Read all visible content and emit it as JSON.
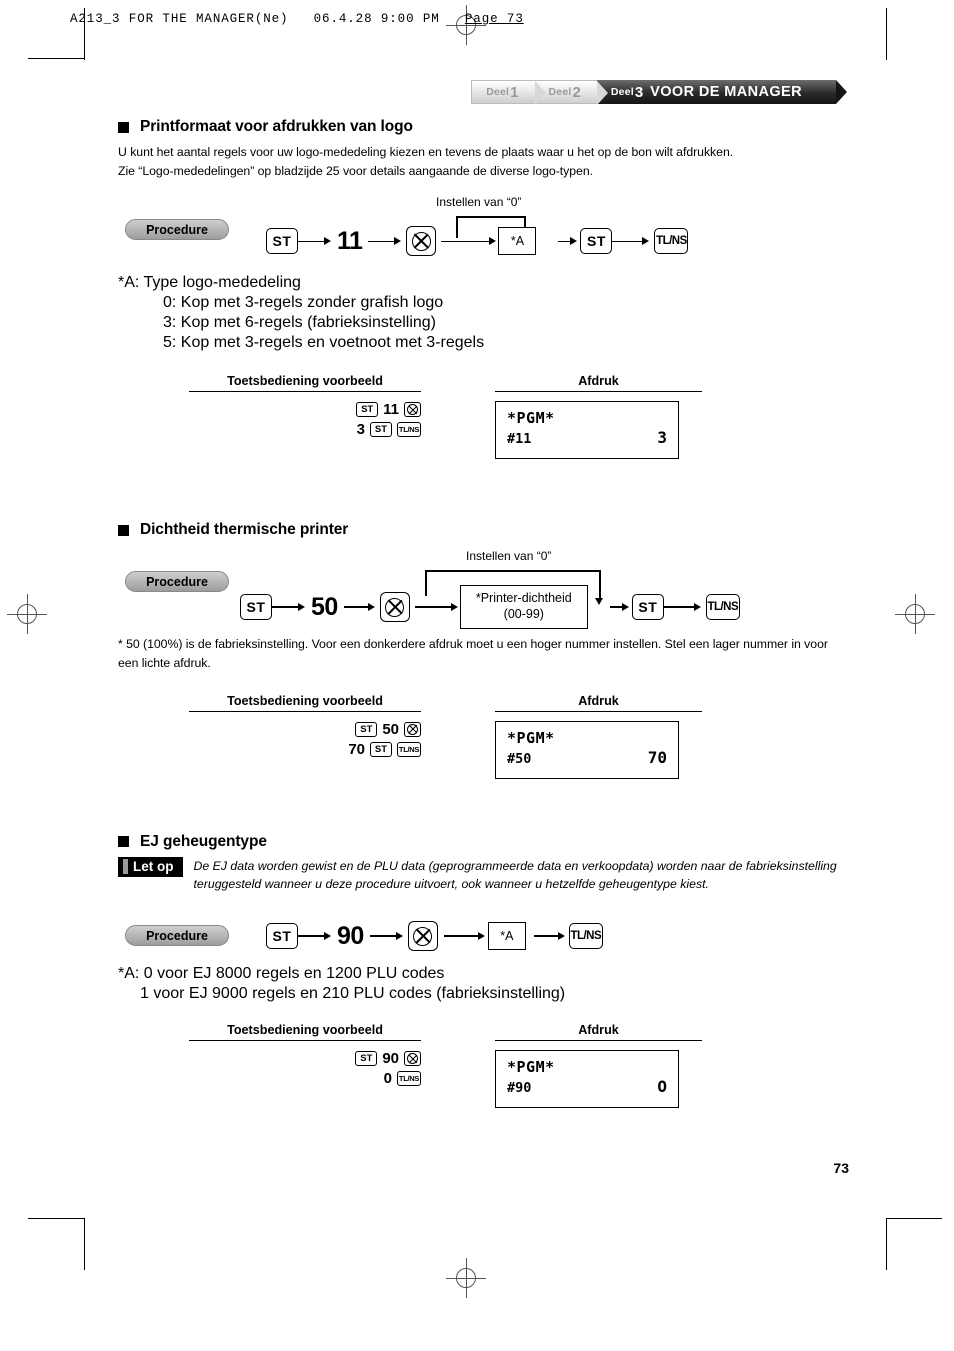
{
  "running_head": {
    "file": "A213_3 FOR THE MANAGER(Ne)",
    "date": "06.4.28",
    "time": "9:00 PM",
    "page_label": "Page 73"
  },
  "tabs": [
    {
      "word": "Deel",
      "number": "1",
      "title": "",
      "active": false
    },
    {
      "word": "Deel",
      "number": "2",
      "title": "",
      "active": false
    },
    {
      "word": "Deel",
      "number": "3",
      "title": "VOOR DE MANAGER",
      "active": true
    }
  ],
  "sections": [
    {
      "heading": "Printformaat voor afdrukken van logo",
      "body": [
        "U kunt het aantal regels voor uw logo-mededeling kiezen en tevens de plaats waar u het op de bon wilt afdrukken.",
        "Zie “Logo-mededelingen” op bladzijde 25 voor details aangaande de diverse logo-typen."
      ],
      "procedure_label": "Procedure",
      "bypass_label": "Instellen van “0”",
      "flow": {
        "key_st": "ST",
        "code": "11",
        "key_multiply": "multiply-key-icon",
        "entry": "*A",
        "key_st2": "ST",
        "key_tlns": "TL/NS"
      },
      "notes_title": "*A:   Type logo-mededeling",
      "notes": [
        "0:  Kop met 3-regels zonder grafish logo",
        "3:  Kop met 6-regels (fabrieksinstelling)",
        "5:  Kop met 3-regels en voetnoot met 3-regels"
      ],
      "example": {
        "key_header": "Toetsbediening voorbeeld",
        "print_header": "Afdruk",
        "keys_line1": [
          "ST",
          "11",
          "multiply"
        ],
        "keys_line2": [
          "3",
          "ST",
          "TL/NS"
        ],
        "receipt": {
          "title": "*PGM*",
          "label": "#11",
          "value": "3"
        }
      }
    },
    {
      "heading": "Dichtheid thermische printer",
      "body": [],
      "procedure_label": "Procedure",
      "bypass_label": "Instellen van “0”",
      "flow": {
        "key_st": "ST",
        "code": "50",
        "key_multiply": "multiply-key-icon",
        "entry_line1": "*Printer-dichtheid",
        "entry_line2": "(00-99)",
        "key_st2": "ST",
        "key_tlns": "TL/NS"
      },
      "footnote": "* 50 (100%) is de fabrieksinstelling. Voor een donkerdere afdruk moet u een hoger nummer instellen. Stel een lager nummer in voor een lichte afdruk.",
      "example": {
        "key_header": "Toetsbediening voorbeeld",
        "print_header": "Afdruk",
        "keys_line1": [
          "ST",
          "50",
          "multiply"
        ],
        "keys_line2": [
          "70",
          "ST",
          "TL/NS"
        ],
        "receipt": {
          "title": "*PGM*",
          "label": "#50",
          "value": "70"
        }
      }
    },
    {
      "heading": "EJ geheugentype",
      "caution_badge": "Let op",
      "caution_text": "De EJ data worden gewist en de PLU data (geprogrammeerde data en verkoopdata) worden naar de fabrieksinstelling teruggesteld wanneer u deze procedure uitvoert, ook wanneer u hetzelfde geheugentype kiest.",
      "procedure_label": "Procedure",
      "flow": {
        "key_st": "ST",
        "code": "90",
        "key_multiply": "multiply-key-icon",
        "entry": "*A",
        "key_tlns": "TL/NS"
      },
      "notes": [
        "*A: 0 voor EJ 8000 regels en 1200 PLU codes",
        "1 voor EJ 9000 regels en 210 PLU codes (fabrieksinstelling)"
      ],
      "example": {
        "key_header": "Toetsbediening voorbeeld",
        "print_header": "Afdruk",
        "keys_line1": [
          "ST",
          "90",
          "multiply"
        ],
        "keys_line2": [
          "0",
          "TL/NS"
        ],
        "receipt": {
          "title": "*PGM*",
          "label": "#90",
          "value": "O"
        }
      }
    }
  ],
  "page_number": "73"
}
